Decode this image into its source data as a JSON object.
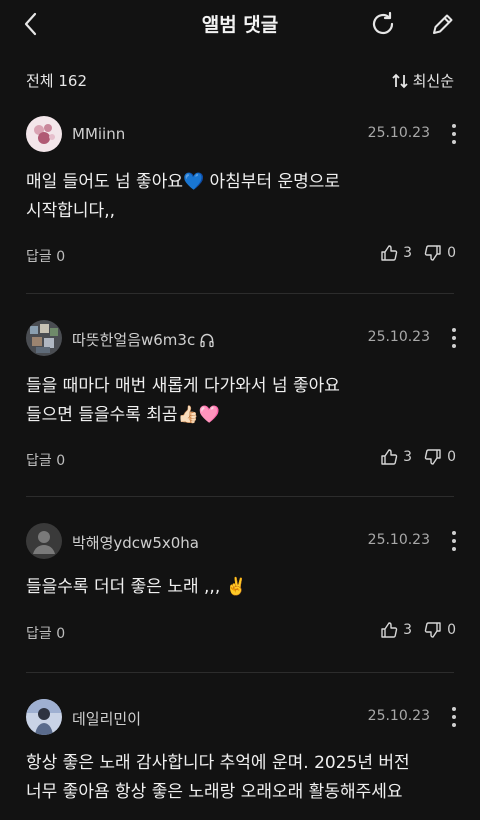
{
  "header": {
    "title": "앨범 댓글"
  },
  "summary": {
    "total": "전체 162",
    "sort": "최신순"
  },
  "comments": [
    {
      "user": "MMiinn",
      "date": "25.10.23",
      "line1": "매일 들어도 넘 좋아요💙 아침부터 운명으로",
      "line2": "시작합니다,,",
      "reply": "답글 0",
      "like": "3",
      "dislike": "0",
      "headphone": false
    },
    {
      "user": "따뜻한얼음w6m3c",
      "date": "25.10.23",
      "line1": "들을 때마다 매번 새롭게 다가와서 넘 좋아요",
      "line2": "들으면 들을수록 최곰👍🏻🩷",
      "reply": "답글 0",
      "like": "3",
      "dislike": "0",
      "headphone": true
    },
    {
      "user": "박해영ydcw5x0ha",
      "date": "25.10.23",
      "line1": "들을수록 더더 좋은 노래 ,,, ✌️",
      "line2": "",
      "reply": "답글 0",
      "like": "3",
      "dislike": "0",
      "headphone": false
    },
    {
      "user": "데일리민이",
      "date": "25.10.23",
      "line1": "항상 좋은 노래 감사합니다 추억에 운며. 2025년 버전",
      "line2": "너무 좋아욤 항상 좋은 노래랑 오래오래 활동해주세요",
      "reply": "",
      "like": "",
      "dislike": "",
      "headphone": false
    }
  ]
}
